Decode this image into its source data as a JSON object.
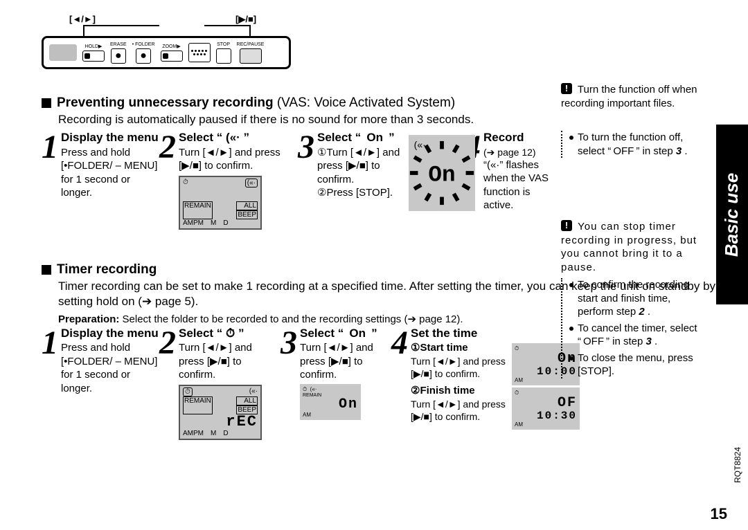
{
  "side_tab": "Basic use",
  "page_number": "15",
  "doc_id": "RQT8824",
  "device": {
    "top_left_label": "[◄/►]",
    "top_right_label": "[▶/■]",
    "labels": {
      "hold": "HOLD▶",
      "erase": "ERASE",
      "folder": "• FOLDER",
      "zoom": "ZOOM▶",
      "stop": "STOP",
      "rec": "REC/PAUSE"
    }
  },
  "section1": {
    "heading_bold": "Preventing unnecessary recording",
    "heading_rest": "(VAS: Voice Activated System)",
    "description": "Recording is automatically paused if there is no sound for more than 3 seconds.",
    "steps": {
      "s1": {
        "title": "Display the menu",
        "text": "Press and hold [•FOLDER/ – MENU] for 1 second or longer."
      },
      "s2": {
        "title": "Select “ («· ”",
        "text": "Turn [◄/►] and press [▶/■] to confirm."
      },
      "s3": {
        "title": "Select “  On  ”",
        "l1": "①Turn [◄/►] and press [▶/■] to confirm.",
        "l2": "②Press [STOP]."
      },
      "s4": {
        "title": "Record",
        "link": "➔ page 12)",
        "text": "“(«·” flashes when the VAS function is active."
      }
    },
    "panel": {
      "top_left": "⏱",
      "top_right": "(«·",
      "remain": "REMAIN",
      "all": "ALL",
      "beep": "BEEP",
      "bottom": "AMPM M D"
    }
  },
  "section2": {
    "heading": "Timer recording",
    "description": "Timer recording can be set to make 1 recording at a specified time. After setting the timer, you can keep the unit on standby by setting hold on (➔ page 5).",
    "prep_label": "Preparation:",
    "prep_text": "Select the folder to be recorded to and the recording settings (➔ page 12).",
    "steps": {
      "s1": {
        "title": "Display the menu",
        "text": "Press and hold [•FOLDER/ – MENU] for 1 second or longer."
      },
      "s2": {
        "title": "Select “ ⏱ ”",
        "text": "Turn [◄/►] and press [▶/■] to confirm."
      },
      "s3": {
        "title": "Select “  On  ”",
        "text": "Turn [◄/►] and press [▶/■] to confirm."
      },
      "s4": {
        "title": "Set the time",
        "sub1": "①Start time",
        "sub1_text": "Turn [◄/►] and press [▶/■] to confirm.",
        "sub2": "②Finish time",
        "sub2_text": "Turn [◄/►] and press [▶/■] to confirm."
      }
    },
    "panel": {
      "top_left": "⏱",
      "top_right": "(«·",
      "remain": "REMAIN",
      "all": "ALL",
      "beep": "BEEP",
      "rec": "rEC",
      "bottom": "AMPM M D"
    },
    "mini_on": {
      "on": "On",
      "am": "AM"
    },
    "lcd_start": {
      "big": "On",
      "time": "10:00",
      "am": "AM"
    },
    "lcd_finish": {
      "big": "OF",
      "time": "10:30",
      "am": "AM"
    }
  },
  "notes": {
    "n1": "Turn the function off when recording important files.",
    "n2a": "To turn the function off, select “ OFF ” in step ",
    "n2b": "3",
    "n2c": ".",
    "n3": "You can stop timer recording in progress, but you cannot bring it to a pause.",
    "n4a": "To confirm the recording start and finish time, perform step ",
    "n4b": "2",
    "n4c": ".",
    "n5a": "To cancel the timer, select “ OFF ” in step ",
    "n5b": "3",
    "n5c": ".",
    "n6": "To close the menu, press [STOP]."
  }
}
